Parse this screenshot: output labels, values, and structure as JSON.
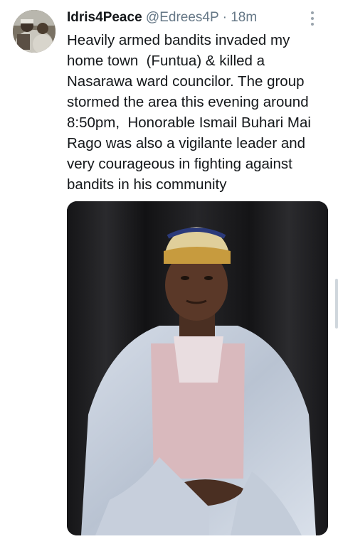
{
  "tweet": {
    "author": {
      "display_name": "Idris4Peace",
      "handle": "@Edrees4P",
      "separator": "·",
      "time": "18m",
      "avatar_icon": "user-avatar-photo"
    },
    "more_icon": "more-vertical-icon",
    "text": "Heavily armed bandits invaded my\nhome town  (Funtua) & killed a\nNasarawa ward councilor. The group\nstormed the area this evening around\n8:50pm,  Honorable Ismail Buhari Mai\nRago was also a vigilante leader and\nvery courageous in fighting against\nbandits in his community",
    "media": {
      "type": "photo",
      "subject_icon": "portrait-photo"
    }
  },
  "colors": {
    "primary_text": "#14171a",
    "secondary_text": "#657786",
    "background": "#ffffff"
  }
}
